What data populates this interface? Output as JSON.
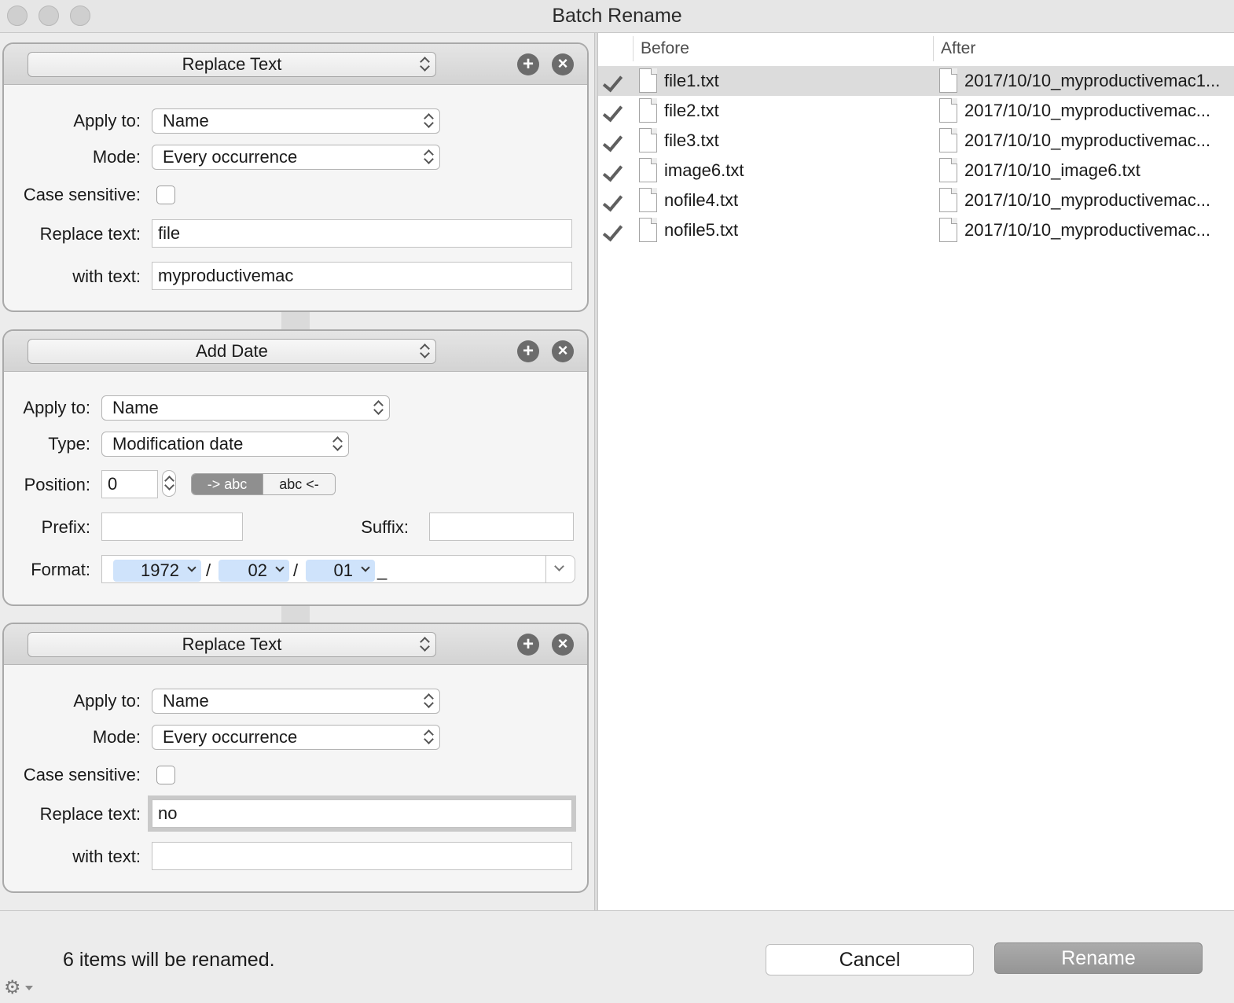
{
  "window": {
    "title": "Batch Rename"
  },
  "rules": [
    {
      "type": "Replace Text",
      "apply_to_label": "Apply to:",
      "apply_to": "Name",
      "mode_label": "Mode:",
      "mode": "Every occurrence",
      "case_label": "Case sensitive:",
      "case_sensitive": false,
      "replace_label": "Replace text:",
      "replace_text": "file",
      "with_label": "with text:",
      "with_text": "myproductivemac"
    },
    {
      "type": "Add Date",
      "apply_to_label": "Apply to:",
      "apply_to": "Name",
      "type_label": "Type:",
      "date_type": "Modification date",
      "position_label": "Position:",
      "position": "0",
      "position_options": [
        "-> abc",
        "abc <-"
      ],
      "prefix_label": "Prefix:",
      "prefix": "",
      "suffix_label": "Suffix:",
      "suffix": "",
      "format_label": "Format:",
      "format_tokens": [
        "1972",
        "02",
        "01"
      ],
      "format_separators": [
        "/",
        "/",
        "_"
      ]
    },
    {
      "type": "Replace Text",
      "apply_to_label": "Apply to:",
      "apply_to": "Name",
      "mode_label": "Mode:",
      "mode": "Every occurrence",
      "case_label": "Case sensitive:",
      "case_sensitive": false,
      "replace_label": "Replace text:",
      "replace_text": "no",
      "with_label": "with text:",
      "with_text": ""
    }
  ],
  "table": {
    "columns": [
      "Before",
      "After"
    ],
    "rows": [
      {
        "before": "file1.txt",
        "after": "2017/10/10_myproductivemac1...",
        "selected": true
      },
      {
        "before": "file2.txt",
        "after": "2017/10/10_myproductivemac...",
        "selected": false
      },
      {
        "before": "file3.txt",
        "after": "2017/10/10_myproductivemac...",
        "selected": false
      },
      {
        "before": "image6.txt",
        "after": "2017/10/10_image6.txt",
        "selected": false
      },
      {
        "before": "nofile4.txt",
        "after": "2017/10/10_myproductivemac...",
        "selected": false
      },
      {
        "before": "nofile5.txt",
        "after": "2017/10/10_myproductivemac...",
        "selected": false
      }
    ]
  },
  "footer": {
    "status": "6 items will be renamed.",
    "cancel_label": "Cancel",
    "rename_label": "Rename"
  },
  "icons": {
    "add": "plus-circle-icon",
    "remove": "x-circle-icon",
    "check": "checkmark-icon",
    "file": "document-icon",
    "gear": "gear-icon"
  },
  "colors": {
    "accent_token": "#cfe3fb",
    "selected_row": "#dcdcdc",
    "rename_button": "#a0a0a0"
  }
}
